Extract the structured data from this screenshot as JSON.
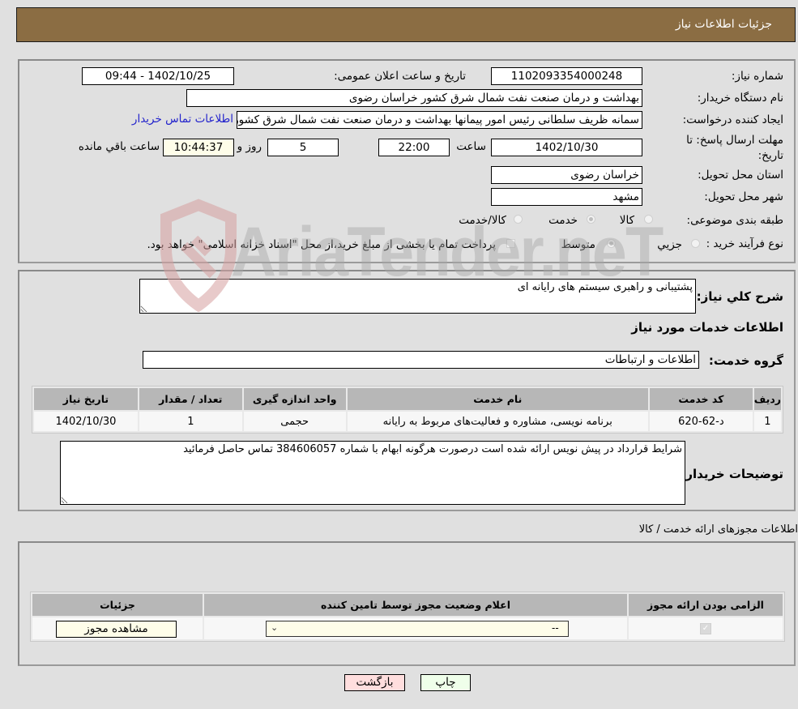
{
  "header": {
    "title": "جزئیات اطلاعات نیاز"
  },
  "details": {
    "need_number_label": "شماره نیاز:",
    "need_number": "1102093354000248",
    "announce_label": "تاریخ و ساعت اعلان عمومی:",
    "announce_value": "1402/10/25 - 09:44",
    "buyer_org_label": "نام دستگاه خریدار:",
    "buyer_org": "بهداشت و درمان صنعت نفت شمال شرق کشور   خراسان رضوی",
    "requester_label": "ایجاد کننده درخواست:",
    "requester": "سمانه ظریف سلطانی رئیس امور پیمانها بهداشت و درمان صنعت نفت شمال شرق کشور",
    "contact_link": "اطلاعات تماس خریدار",
    "deadline_label": "مهلت ارسال پاسخ: تا تاریخ:",
    "deadline_date": "1402/10/30",
    "time_label": "ساعت",
    "deadline_time": "22:00",
    "days": "5",
    "days_label": "روز و",
    "remaining_time": "10:44:37",
    "remaining_label": "ساعت باقي مانده",
    "province_label": "استان محل تحویل:",
    "province": "خراسان رضوی",
    "city_label": "شهر محل تحویل:",
    "city": "مشهد",
    "category_label": "طبقه بندی موضوعی:",
    "category_options": [
      {
        "label": "کالا",
        "checked": false
      },
      {
        "label": "خدمت",
        "checked": true
      },
      {
        "label": "کالا/خدمت",
        "checked": false
      }
    ],
    "process_label": "نوع فرآیند خرید :",
    "process_options": [
      {
        "label": "جزيي",
        "checked": false
      },
      {
        "label": "متوسط",
        "checked": true
      }
    ],
    "treasury_note": "پرداخت تمام یا بخشی از مبلغ خرید،از محل \"اسناد خزانه اسلامی\" خواهد بود."
  },
  "description": {
    "label": "شرح کلي نیاز:",
    "value": "پشتیبانی و راهبری سیستم های رایانه ای",
    "services_heading": "اطلاعات خدمات مورد نیاز",
    "service_group_label": "گروه خدمت:",
    "service_group": "اطلاعات و ارتباطات"
  },
  "services_table": {
    "headers": [
      "ردیف",
      "کد خدمت",
      "نام خدمت",
      "واحد اندازه گیری",
      "تعداد / مقدار",
      "تاریخ نیاز"
    ],
    "rows": [
      [
        "1",
        "د-62-620",
        "برنامه نویسی، مشاوره و فعالیت‌های مربوط به رایانه",
        "حجمی",
        "1",
        "1402/10/30"
      ]
    ]
  },
  "buyer_notes": {
    "label": "توضیحات خریدار:",
    "value": "شرایط قرارداد در پیش نویس ارائه شده است درصورت هرگونه ابهام با شماره 384606057 تماس حاصل فرمائید"
  },
  "permits": {
    "heading": "اطلاعات مجوزهای ارائه خدمت / کالا",
    "headers": [
      "الزامی بودن ارائه مجوز",
      "اعلام وضعیت مجوز توسط تامین کننده",
      "جزئیات"
    ],
    "rows": [
      {
        "required": true,
        "status": "--",
        "details_button": "مشاهده مجوز"
      }
    ]
  },
  "footer": {
    "print_button": "چاپ",
    "back_button": "بازگشت"
  },
  "watermark": {
    "text": "AriaTender.neT"
  },
  "colors": {
    "header_bg": "#8b6d43",
    "page_bg": "#e0e0e0",
    "table_header_bg": "#b7b7b7",
    "link": "#2222cc",
    "print_button_bg": "#efffea",
    "back_button_bg": "#ffdede"
  }
}
